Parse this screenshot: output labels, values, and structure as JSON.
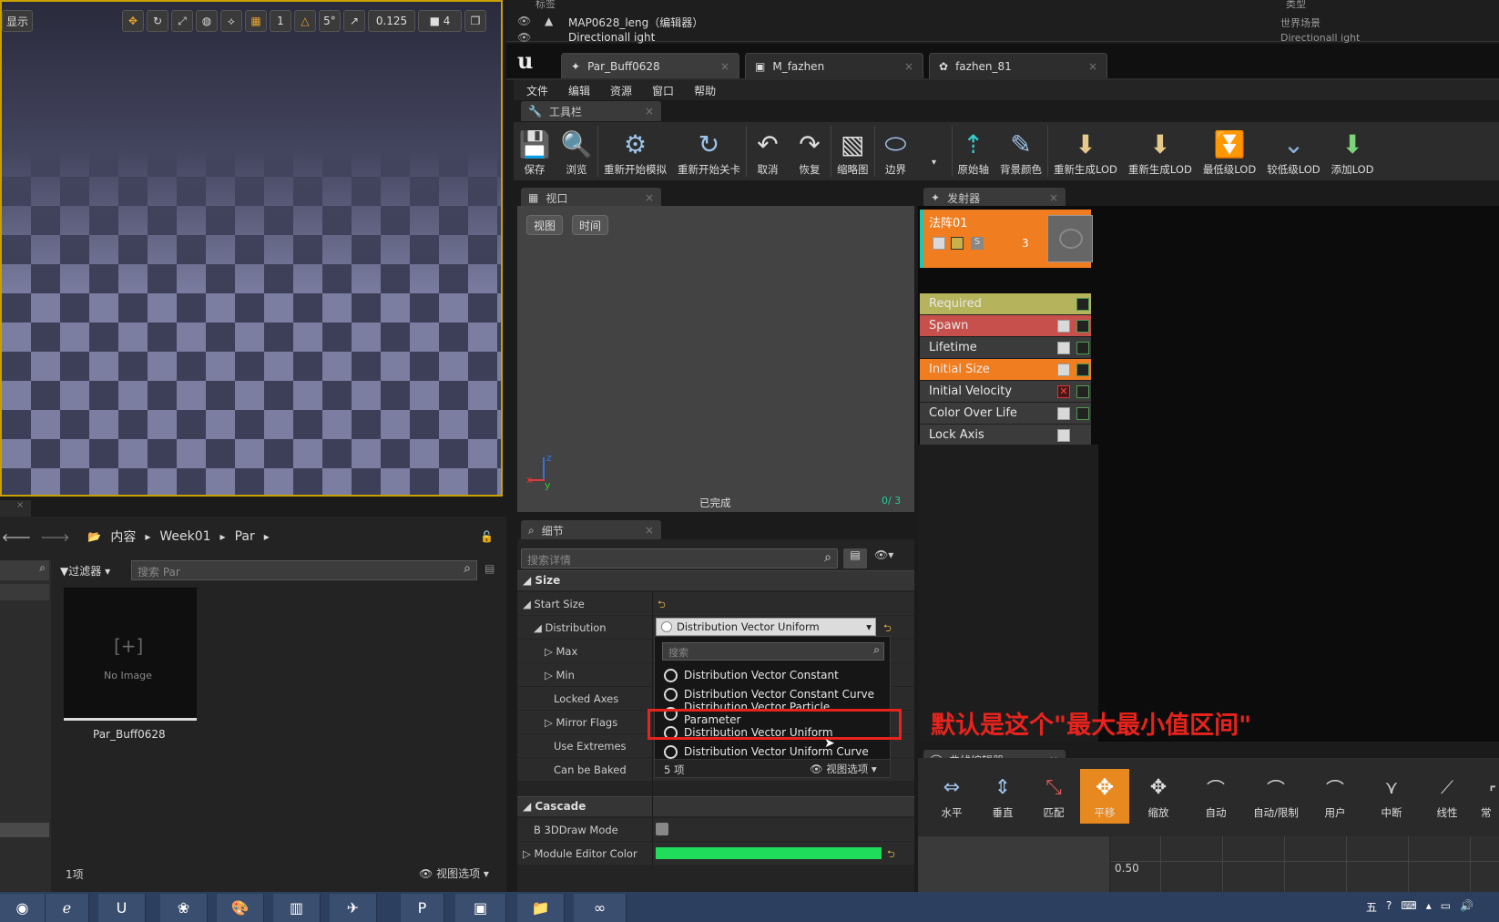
{
  "viewport": {
    "show_label": "显示",
    "snap_angle": "5°",
    "snap_scale": "0.125",
    "camera_speed": "4"
  },
  "outliner": {
    "col_label": "标签",
    "col_type": "类型",
    "row1_name": "MAP0628_leng（编辑器）",
    "row1_type": "世界场景",
    "row2_name": "Directionall ight",
    "row2_type": "Directionall ight"
  },
  "doc_tabs": [
    "Par_Buff0628",
    "M_fazhen",
    "fazhen_81"
  ],
  "menu": [
    "文件",
    "编辑",
    "资源",
    "窗口",
    "帮助"
  ],
  "toolbar": {
    "tab_label": "工具栏",
    "tools": [
      "保存",
      "浏览",
      "重新开始模拟",
      "重新开始关卡",
      "取消",
      "恢复",
      "缩略图",
      "边界",
      "原始轴",
      "背景颜色",
      "重新生成LOD",
      "重新生成LOD",
      "最低级LOD",
      "较低级LOD",
      "添加LOD"
    ]
  },
  "preview": {
    "tab_label": "视口",
    "btn_view": "视图",
    "btn_time": "时间",
    "status": "已完成",
    "counter": "0/ 3"
  },
  "emitters": {
    "tab_label": "发射器",
    "emitter_name": "法阵01",
    "emitter_count": "3",
    "modules": [
      "Required",
      "Spawn",
      "Lifetime",
      "Initial Size",
      "Initial Velocity",
      "Color Over Life",
      "Lock Axis"
    ]
  },
  "details": {
    "tab_label": "细节",
    "search_placeholder": "搜索详情",
    "section_size": "Size",
    "start_size": "Start Size",
    "distribution": "Distribution",
    "distribution_value": "Distribution Vector Uniform",
    "max": "Max",
    "min": "Min",
    "locked_axes": "Locked Axes",
    "mirror_flags": "Mirror Flags",
    "use_extremes": "Use Extremes",
    "can_be_baked": "Can be Baked",
    "section_cascade": "Cascade",
    "b3d_draw_mode": "B 3DDraw Mode",
    "module_editor_color": "Module Editor Color"
  },
  "dropdown": {
    "search_placeholder": "搜索",
    "items": [
      "Distribution Vector Constant",
      "Distribution Vector Constant Curve",
      "Distribution Vector Particle Parameter",
      "Distribution Vector Uniform",
      "Distribution Vector Uniform Curve"
    ],
    "count": "5 项",
    "view_options": "视图选项"
  },
  "annotation": "默认是这个\"最大最小值区间\"",
  "content_browser": {
    "path": [
      "内容",
      "Week01",
      "Par"
    ],
    "filter": "过滤器",
    "search_placeholder": "搜索 Par",
    "asset_name": "Par_Buff0628",
    "no_image": "No Image",
    "count": "1项",
    "view_options": "视图选项"
  },
  "curve_editor": {
    "tab_label": "曲线编辑器",
    "tools": [
      "水平",
      "垂直",
      "匹配",
      "平移",
      "缩放",
      "自动",
      "自动/限制",
      "用户",
      "中断",
      "线性",
      "常"
    ],
    "value": "0.50"
  },
  "colors": {
    "emitter_orange": "#f07d1f",
    "required": "#b5b35c",
    "spawn": "#c8504c",
    "highlight": "#e8231d",
    "module_color": "#1fdc5a"
  }
}
